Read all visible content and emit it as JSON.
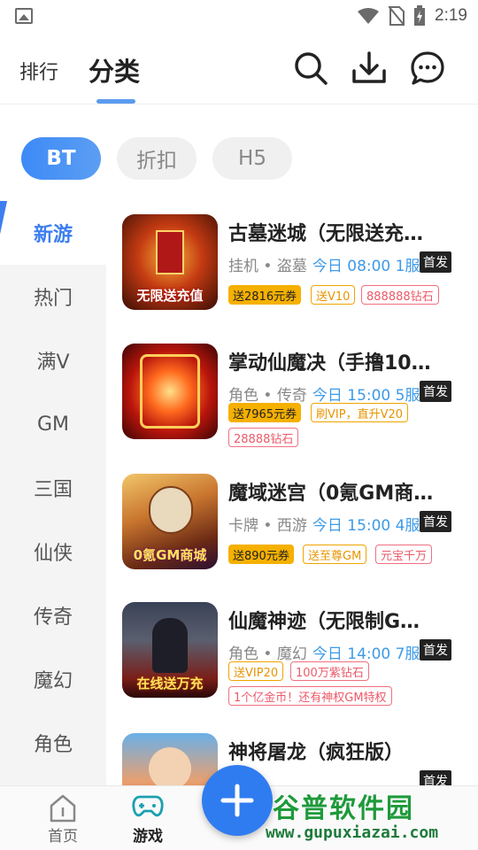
{
  "status_bar": {
    "time": "2:19"
  },
  "header": {
    "tab_rank": "排行",
    "tab_category": "分类"
  },
  "chips": [
    "BT",
    "折扣",
    "H5"
  ],
  "categories": [
    "新游",
    "热门",
    "满V",
    "GM",
    "三国",
    "仙侠",
    "传奇",
    "魔幻",
    "角色"
  ],
  "games": [
    {
      "title": "古墓迷城（无限送充…",
      "genre": "挂机 • 盗墓",
      "time": "今日 08:00 1服",
      "badge": "首发",
      "thumb_text": "无限送充值",
      "tags": [
        "送2816元券",
        "送V10",
        "888888钻石"
      ]
    },
    {
      "title": "掌动仙魔决（手撸10…",
      "genre": "角色 • 传奇",
      "time": "今日 15:00 5服",
      "badge": "首发",
      "thumb_text": "",
      "tags": [
        "送7965元券",
        "刷VIP，直升V20",
        "28888钻石"
      ]
    },
    {
      "title": "魔域迷宫（0氪GM商…",
      "genre": "卡牌 • 西游",
      "time": "今日 15:00 4服",
      "badge": "首发",
      "thumb_text": "0氪GM商城",
      "tags": [
        "送890元券",
        "送至尊GM",
        "元宝千万"
      ]
    },
    {
      "title": "仙魔神迹（无限制G…",
      "genre": "角色 • 魔幻",
      "time": "今日 14:00 7服",
      "badge": "首发",
      "thumb_text": "在线送万充",
      "tags": [
        "送VIP20",
        "100万紫钻石",
        "1个亿金币！还有神权GM特权"
      ]
    },
    {
      "title": "神将屠龙（疯狂版）",
      "genre": "",
      "time": "",
      "badge": "首发",
      "thumb_text": "",
      "tags": []
    }
  ],
  "bottom_nav": {
    "home": "首页",
    "games": "游戏"
  },
  "watermark": {
    "main": "谷普软件园",
    "url": "www.gupuxiazai.com"
  },
  "colors": {
    "accent": "#3d7ef0",
    "time_blue": "#3d9ae8",
    "gold": "#f5b000"
  }
}
